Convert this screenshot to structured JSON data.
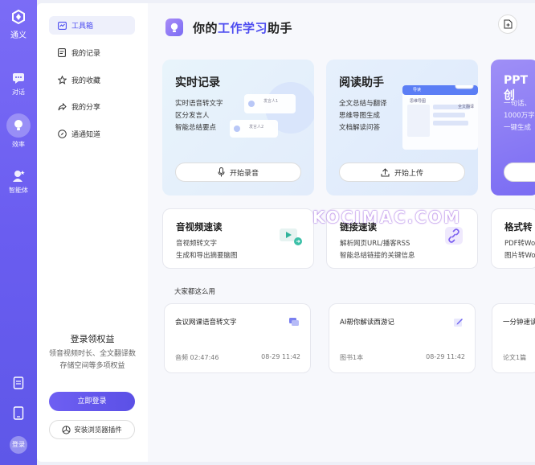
{
  "rail": {
    "logo_label": "通义",
    "items": [
      {
        "label": "对话",
        "icon": "chat-icon"
      },
      {
        "label": "效率",
        "icon": "lightbulb-icon"
      },
      {
        "label": "智能体",
        "icon": "agent-icon"
      }
    ],
    "bottom": {
      "doc_icon": "document-icon",
      "tablet_icon": "tablet-icon",
      "login_label": "登录"
    }
  },
  "sidebar": {
    "items": [
      {
        "label": "工具箱",
        "icon": "toolbox-icon"
      },
      {
        "label": "我的记录",
        "icon": "record-icon"
      },
      {
        "label": "我的收藏",
        "icon": "star-icon"
      },
      {
        "label": "我的分享",
        "icon": "share-icon"
      },
      {
        "label": "通通知道",
        "icon": "compass-icon"
      }
    ],
    "promo": {
      "title": "登录领权益",
      "line1": "领音视频时长、全文翻译数",
      "line2": "存储空间等多项权益",
      "login_button": "立即登录",
      "extension_button": "安装浏览器插件"
    }
  },
  "header": {
    "title_prefix": "你的",
    "title_highlight": "工作学习",
    "title_suffix": "助手"
  },
  "feature_cards": [
    {
      "title": "实时记录",
      "lines": [
        "实时语音转文字",
        "区分发言人",
        "智能总结要点"
      ],
      "button": "开始录音",
      "bg": "#e6f1fb",
      "mock_labels": [
        "发言人1",
        "发言人2"
      ]
    },
    {
      "title": "阅读助手",
      "lines": [
        "全文总结与翻译",
        "思维导图生成",
        "文档解读问答"
      ],
      "button": "开始上传",
      "bg": "#e4eefc",
      "mock_labels": [
        "导读",
        "思维导图",
        "全文翻译"
      ]
    },
    {
      "title": "PPT创",
      "lines": [
        "一句话、",
        "1000万字",
        "一键生成"
      ],
      "button": "",
      "bg": "#8b78f3"
    }
  ],
  "tool_cards": [
    {
      "title": "音视频速读",
      "lines": [
        "音视频转文字",
        "生成和导出摘要脑图"
      ]
    },
    {
      "title": "链接速读",
      "lines": [
        "解析网页URL/播客RSS",
        "智能总结链接的关键信息"
      ]
    },
    {
      "title": "格式转",
      "lines": [
        "PDF转Wo",
        "图片转Wo"
      ]
    }
  ],
  "watermark": "KOCIMAC.COM",
  "popular": {
    "label": "大家都这么用",
    "cards": [
      {
        "title": "会议网课语音转文字",
        "meta_left": "音频 02:47:46",
        "meta_right": "08-29 11:42",
        "icon": "chat-bubble-icon"
      },
      {
        "title": "AI帮你解读西游记",
        "meta_left": "图书1本",
        "meta_right": "08-29 11:42",
        "icon": "edit-icon"
      },
      {
        "title": "一分钟速读",
        "meta_left": "论文1篇",
        "meta_right": "",
        "icon": ""
      }
    ]
  },
  "colors": {
    "accent": "#5b50e6",
    "rail": "#6a5df0",
    "highlight": "#4d4cf0"
  }
}
